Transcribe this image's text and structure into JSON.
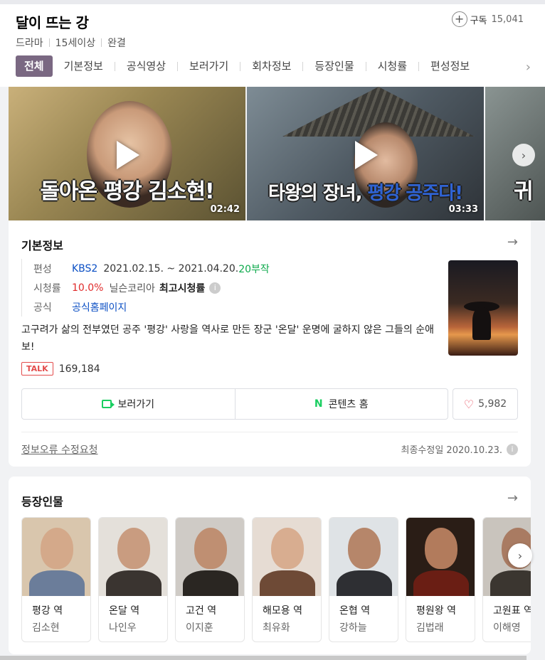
{
  "header": {
    "title": "달이 뜨는 강",
    "subscribe_label": "구독",
    "subscribe_count": "15,041",
    "meta": [
      "드라마",
      "15세이상",
      "완결"
    ],
    "tabs": [
      "전체",
      "기본정보",
      "공식영상",
      "보러가기",
      "회차정보",
      "등장인물",
      "시청률",
      "편성정보"
    ]
  },
  "videos": [
    {
      "caption": "돌아온 평강 김소현!",
      "duration": "02:42"
    },
    {
      "caption_a": "타왕의 장녀, ",
      "caption_b": "평강 공주다!",
      "duration": "03:33"
    },
    {
      "caption": "귀"
    }
  ],
  "basic_info": {
    "title": "기본정보",
    "rows": {
      "schedule_key": "편성",
      "channel": "KBS2",
      "period": "2021.02.15. ~ 2021.04.20.",
      "episodes": "20부작",
      "rating_key": "시청률",
      "rating_value": "10.0%",
      "rating_source": "닐슨코리아",
      "rating_type": "최고시청률",
      "official_key": "공식",
      "official_link": "공식홈페이지"
    },
    "description": "고구려가 삶의 전부였던 공주 '평강' 사랑을 역사로 만든 장군 '온달' 운명에 굴하지 않은 그들의 순애보!",
    "talk_badge": "TALK",
    "talk_count": "169,184",
    "watch_button": "보러가기",
    "content_home_button": "콘텐츠 홈",
    "like_count": "5,982",
    "report_link": "정보오류 수정요청",
    "updated": "최종수정일 2020.10.23."
  },
  "cast": {
    "title": "등장인물",
    "members": [
      {
        "role": "평강 역",
        "actor": "김소현"
      },
      {
        "role": "온달 역",
        "actor": "나인우"
      },
      {
        "role": "고건 역",
        "actor": "이지훈"
      },
      {
        "role": "해모용 역",
        "actor": "최유화"
      },
      {
        "role": "온협 역",
        "actor": "강하늘"
      },
      {
        "role": "평원왕 역",
        "actor": "김법래"
      },
      {
        "role": "고원표 역",
        "actor": "이해영"
      }
    ]
  },
  "colors": {
    "tab_active": "#7a6882",
    "link": "#0b4fc4",
    "green": "#0ca94b",
    "red": "#e02a2a"
  }
}
